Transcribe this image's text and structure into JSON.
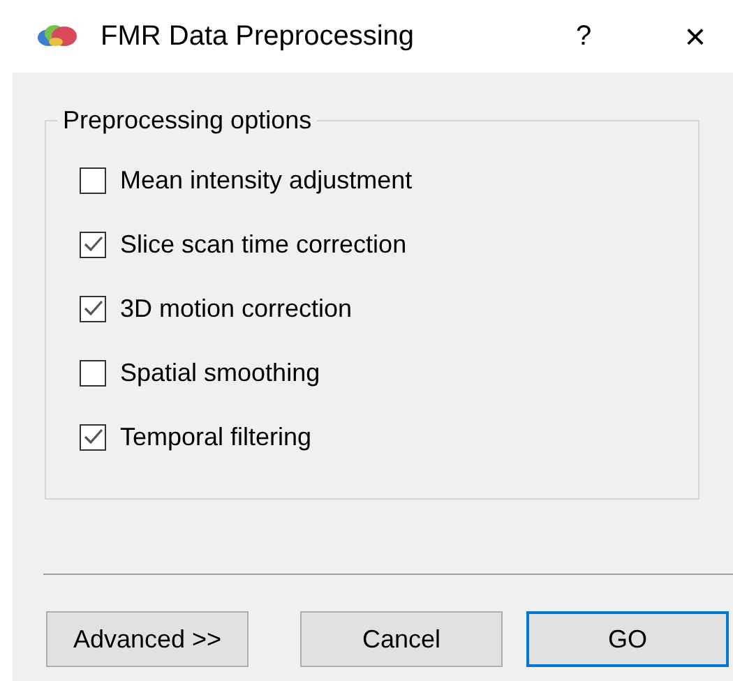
{
  "window": {
    "title": "FMR Data Preprocessing",
    "help": "?",
    "close": "×"
  },
  "group": {
    "title": "Preprocessing options",
    "options": [
      {
        "label": "Mean intensity adjustment",
        "checked": false
      },
      {
        "label": "Slice scan time correction",
        "checked": true
      },
      {
        "label": "3D motion correction",
        "checked": true
      },
      {
        "label": "Spatial smoothing",
        "checked": false
      },
      {
        "label": "Temporal filtering",
        "checked": true
      }
    ]
  },
  "buttons": [
    {
      "label": "Advanced >>",
      "default": false
    },
    {
      "label": "Cancel",
      "default": false
    },
    {
      "label": "GO",
      "default": true
    }
  ]
}
